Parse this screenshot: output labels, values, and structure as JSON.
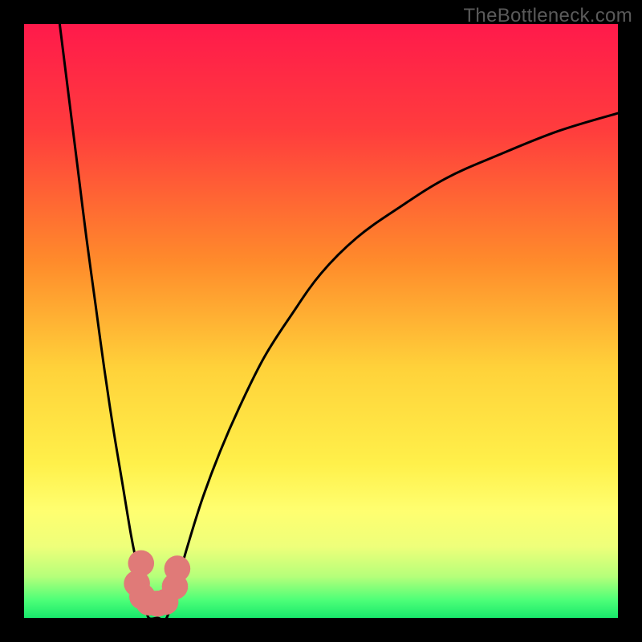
{
  "watermark": "TheBottleneck.com",
  "chart_data": {
    "type": "line",
    "title": "",
    "xlabel": "",
    "ylabel": "",
    "xlim": [
      0,
      100
    ],
    "ylim": [
      0,
      100
    ],
    "gradient_stops": [
      {
        "offset": 0,
        "color": "#ff1a4b"
      },
      {
        "offset": 18,
        "color": "#ff3d3d"
      },
      {
        "offset": 40,
        "color": "#ff8b2b"
      },
      {
        "offset": 58,
        "color": "#ffd23a"
      },
      {
        "offset": 74,
        "color": "#fff04a"
      },
      {
        "offset": 82,
        "color": "#ffff70"
      },
      {
        "offset": 88,
        "color": "#eeff7a"
      },
      {
        "offset": 93,
        "color": "#b6ff7a"
      },
      {
        "offset": 97,
        "color": "#4dff78"
      },
      {
        "offset": 100,
        "color": "#18e86b"
      }
    ],
    "series": [
      {
        "name": "left-curve",
        "x": [
          6.0,
          7.5,
          9.0,
          10.5,
          12.0,
          13.5,
          15.0,
          16.5,
          18.0,
          19.0,
          19.8,
          20.5,
          21.0
        ],
        "y": [
          100,
          88,
          76,
          64,
          53,
          42,
          32,
          23,
          14,
          9,
          5,
          2,
          0
        ]
      },
      {
        "name": "right-curve",
        "x": [
          24.0,
          25.5,
          27.5,
          30.0,
          33.0,
          36.5,
          40.5,
          45.0,
          50.0,
          56.0,
          63.0,
          71.0,
          80.0,
          90.0,
          100.0
        ],
        "y": [
          0,
          5,
          12,
          20,
          28,
          36,
          44,
          51,
          58,
          64,
          69,
          74,
          78,
          82,
          85
        ]
      }
    ],
    "markers": [
      {
        "x": 19.7,
        "y": 9.2
      },
      {
        "x": 19.0,
        "y": 5.8
      },
      {
        "x": 19.9,
        "y": 3.6
      },
      {
        "x": 21.0,
        "y": 2.6
      },
      {
        "x": 22.5,
        "y": 2.4
      },
      {
        "x": 23.8,
        "y": 2.7
      },
      {
        "x": 25.4,
        "y": 5.3
      },
      {
        "x": 25.8,
        "y": 8.3
      }
    ],
    "marker_color": "#e07a78",
    "marker_radius": 2.2
  }
}
